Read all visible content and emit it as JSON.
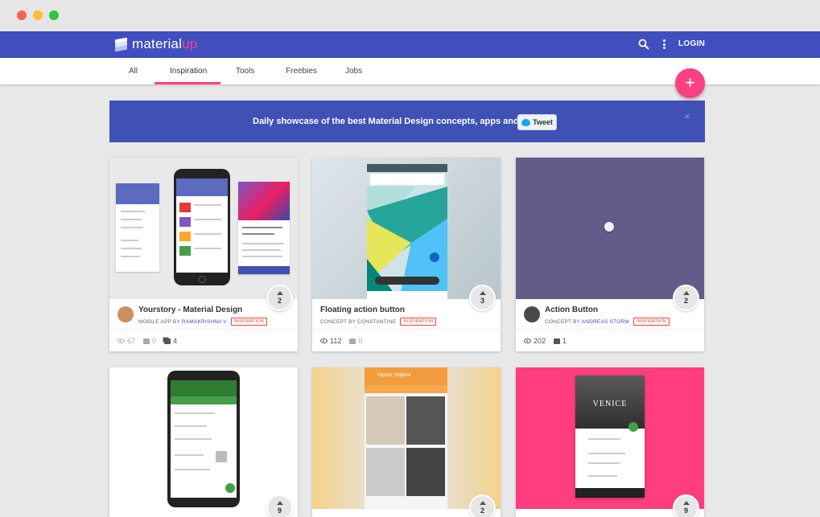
{
  "app": {
    "logo_text_main": "material",
    "logo_text_accent": "up",
    "login_label": "LOGIN"
  },
  "colors": {
    "appbar": "#3f4fbf",
    "accent": "#ff4081",
    "banner": "#3f51b5"
  },
  "icons": {
    "search": "search-icon",
    "more": "more-vert-icon",
    "add": "add-icon",
    "twitter": "twitter-bird-icon",
    "close": "close-icon",
    "views": "eye-icon",
    "comments": "comment-icon",
    "images": "images-icon",
    "upvote": "upvote-arrow-icon"
  },
  "tabs": [
    {
      "label": "All",
      "active": false
    },
    {
      "label": "Inspiration",
      "active": true
    },
    {
      "label": "Tools",
      "active": false
    },
    {
      "label": "Freebies",
      "active": false
    },
    {
      "label": "Jobs",
      "active": false
    }
  ],
  "fab_label": "+",
  "banner": {
    "text": "Daily showcase of the best Material Design concepts, apps and tools!",
    "tweet_label": "Tweet",
    "close_label": "×"
  },
  "cards": [
    {
      "title": "Yourstory - Material Design",
      "category": "MOBILE APP BY",
      "author": "RAMAKRISHNA V",
      "badge": "INSPIRATION",
      "votes": "2",
      "views": "67",
      "comments": "0",
      "images": "4"
    },
    {
      "title": "Floating action button",
      "category": "CONCEPT BY",
      "author": "CONSTANTINE",
      "badge": "INSPIRATION",
      "votes": "3",
      "views": "112",
      "comments": "0"
    },
    {
      "title": "Action Button",
      "category": "CONCEPT BY",
      "author": "ANDREAS STORM",
      "badge": "INSPIRATION",
      "votes": "2",
      "views": "202",
      "comments": "1"
    },
    {
      "votes": "9"
    },
    {
      "votes": "2"
    },
    {
      "votes": "9"
    }
  ],
  "mockups": {
    "venice_title": "VENICE",
    "hipster_title": "Hipster Original"
  }
}
